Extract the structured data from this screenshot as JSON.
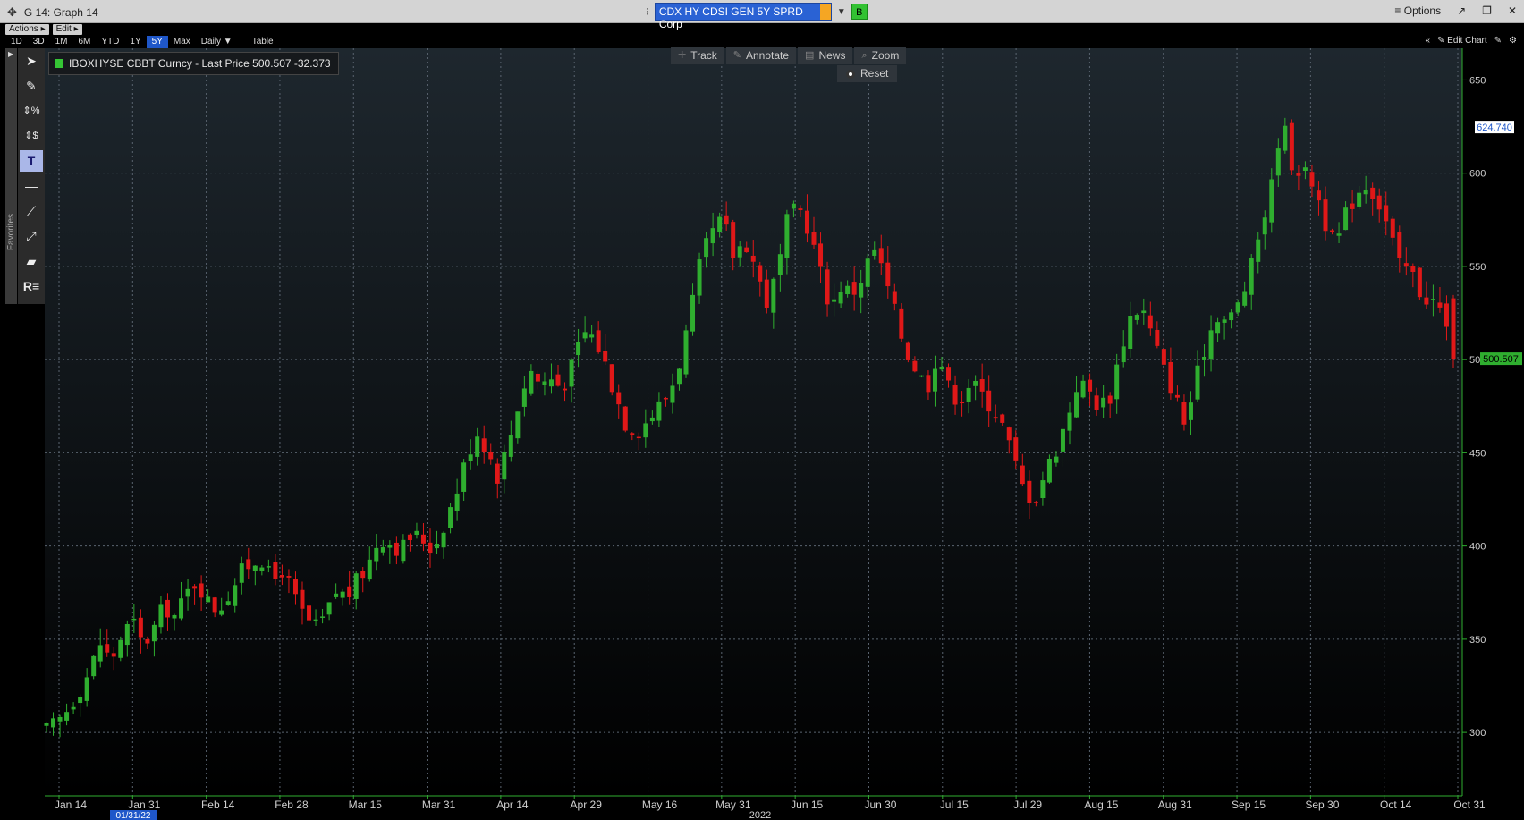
{
  "window": {
    "title": "G 14: Graph 14",
    "ticker": "CDX HY CDSI GEN 5Y SPRD Corp",
    "ticker_badge": "B",
    "options_label": "Options"
  },
  "menu": {
    "actions": "Actions ▸",
    "edit": "Edit ▸"
  },
  "ranges": [
    "1D",
    "3D",
    "1M",
    "6M",
    "YTD",
    "1Y",
    "5Y",
    "Max",
    "Daily ▼",
    "Table"
  ],
  "active_range": "5Y",
  "edit_chart_label": "Edit Chart",
  "favorites_label": "Favorites",
  "overlay": {
    "track": "Track",
    "annotate": "Annotate",
    "news": "News",
    "zoom": "Zoom",
    "reset": "Reset"
  },
  "legend": {
    "label": "IBOXHYSE CBBT Curncy - Last Price 500.507  -32.373",
    "color": "#35c535"
  },
  "colors": {
    "up": "#2fae2f",
    "down": "#e01818",
    "background_top": "#1d252c",
    "background_bottom": "#000000",
    "grid": "#5a6470",
    "last_price_tag": "#2fae2f",
    "high_tag": "#ffffff"
  },
  "chart_data": {
    "type": "candlestick",
    "series_name": "IBOXHYSE CBBT Curncy - Last Price",
    "last_price": "500.507",
    "last_change": "-32.373",
    "high_marker": "624.740",
    "y_ticks": [
      "650",
      "600",
      "550",
      "500",
      "450",
      "400",
      "350",
      "300"
    ],
    "ylim": [
      266,
      667
    ],
    "x_ticks": [
      "Jan 14",
      "Jan 31",
      "Feb 14",
      "Feb 28",
      "Mar 15",
      "Mar 31",
      "Apr 14",
      "Apr 29",
      "May 16",
      "May 31",
      "Jun 15",
      "Jun 30",
      "Jul 15",
      "Jul 29",
      "Aug 15",
      "Aug 31",
      "Sep 15",
      "Sep 30",
      "Oct 14",
      "Oct 31"
    ],
    "x_year_label": "2022",
    "x_date_badge": "01/31/22",
    "grid": true,
    "close_path": [
      [
        0,
        301
      ],
      [
        10,
        305
      ],
      [
        20,
        313
      ],
      [
        30,
        322
      ],
      [
        40,
        333
      ],
      [
        50,
        348
      ],
      [
        60,
        338
      ],
      [
        70,
        352
      ],
      [
        80,
        360
      ],
      [
        90,
        346
      ],
      [
        100,
        356
      ],
      [
        110,
        368
      ],
      [
        120,
        362
      ],
      [
        130,
        374
      ],
      [
        140,
        382
      ],
      [
        150,
        370
      ],
      [
        160,
        366
      ],
      [
        170,
        375
      ],
      [
        180,
        385
      ],
      [
        190,
        391
      ],
      [
        200,
        394
      ],
      [
        210,
        380
      ],
      [
        220,
        388
      ],
      [
        230,
        373
      ],
      [
        240,
        362
      ],
      [
        250,
        356
      ],
      [
        260,
        362
      ],
      [
        270,
        376
      ],
      [
        280,
        373
      ],
      [
        290,
        382
      ],
      [
        300,
        391
      ],
      [
        310,
        405
      ],
      [
        320,
        402
      ],
      [
        330,
        398
      ],
      [
        340,
        406
      ],
      [
        350,
        404
      ],
      [
        360,
        398
      ],
      [
        370,
        412
      ],
      [
        380,
        426
      ],
      [
        390,
        445
      ],
      [
        400,
        462
      ],
      [
        410,
        452
      ],
      [
        420,
        438
      ],
      [
        430,
        455
      ],
      [
        440,
        478
      ],
      [
        450,
        495
      ],
      [
        460,
        487
      ],
      [
        470,
        490
      ],
      [
        480,
        485
      ],
      [
        490,
        497
      ],
      [
        500,
        515
      ],
      [
        510,
        512
      ],
      [
        520,
        498
      ],
      [
        530,
        481
      ],
      [
        540,
        465
      ],
      [
        550,
        462
      ],
      [
        560,
        468
      ],
      [
        570,
        475
      ],
      [
        580,
        482
      ],
      [
        590,
        500
      ],
      [
        600,
        525
      ],
      [
        610,
        555
      ],
      [
        620,
        568
      ],
      [
        630,
        575
      ],
      [
        640,
        555
      ],
      [
        650,
        565
      ],
      [
        660,
        550
      ],
      [
        670,
        530
      ],
      [
        680,
        545
      ],
      [
        690,
        575
      ],
      [
        700,
        582
      ],
      [
        710,
        570
      ],
      [
        720,
        548
      ],
      [
        730,
        528
      ],
      [
        740,
        540
      ],
      [
        750,
        535
      ],
      [
        760,
        545
      ],
      [
        770,
        560
      ],
      [
        780,
        545
      ],
      [
        790,
        525
      ],
      [
        800,
        505
      ],
      [
        810,
        495
      ],
      [
        820,
        485
      ],
      [
        830,
        505
      ],
      [
        840,
        485
      ],
      [
        850,
        478
      ],
      [
        860,
        488
      ],
      [
        870,
        482
      ],
      [
        880,
        475
      ],
      [
        890,
        465
      ],
      [
        900,
        448
      ],
      [
        910,
        430
      ],
      [
        920,
        425
      ],
      [
        930,
        440
      ],
      [
        940,
        452
      ],
      [
        950,
        468
      ],
      [
        960,
        488
      ],
      [
        970,
        484
      ],
      [
        980,
        475
      ],
      [
        990,
        480
      ],
      [
        1000,
        505
      ],
      [
        1010,
        525
      ],
      [
        1020,
        528
      ],
      [
        1030,
        512
      ],
      [
        1040,
        495
      ],
      [
        1050,
        482
      ],
      [
        1060,
        465
      ],
      [
        1070,
        488
      ],
      [
        1080,
        510
      ],
      [
        1090,
        525
      ],
      [
        1100,
        520
      ],
      [
        1110,
        530
      ],
      [
        1120,
        545
      ],
      [
        1130,
        570
      ],
      [
        1140,
        590
      ],
      [
        1150,
        630
      ],
      [
        1160,
        605
      ],
      [
        1170,
        600
      ],
      [
        1180,
        595
      ],
      [
        1190,
        575
      ],
      [
        1200,
        560
      ],
      [
        1210,
        578
      ],
      [
        1220,
        590
      ],
      [
        1230,
        595
      ],
      [
        1240,
        585
      ],
      [
        1250,
        570
      ],
      [
        1260,
        550
      ],
      [
        1270,
        548
      ],
      [
        1280,
        535
      ],
      [
        1290,
        532
      ],
      [
        1300,
        525
      ],
      [
        1310,
        500.507
      ]
    ]
  }
}
